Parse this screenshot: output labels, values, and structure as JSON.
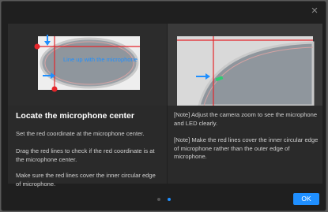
{
  "dialog": {
    "close_symbol": "×",
    "ok_label": "OK",
    "pager": {
      "count": 2,
      "current_index": 1,
      "inactive_color": "#555555",
      "active_color": "#1f8fff"
    }
  },
  "left": {
    "overlay_text": "Line up with the microphone",
    "heading": "Locate the microphone center",
    "paragraphs": [
      "Set the red coordinate at the microphone center.",
      "Drag the red lines to check if the red coordinate is at the microphone center.",
      "Make sure the red lines cover the inner circular edge of microphone."
    ]
  },
  "right": {
    "notes": [
      "[Note] Adjust the camera zoom to see the microphone and LED clearly.",
      "[Note] Make the red lines cover the inner circular edge of microphone rather than the outer edge of microphone."
    ]
  },
  "colors": {
    "accent": "#1f8fff",
    "marker_red": "#e5262b",
    "led_green": "#2ecc71"
  }
}
